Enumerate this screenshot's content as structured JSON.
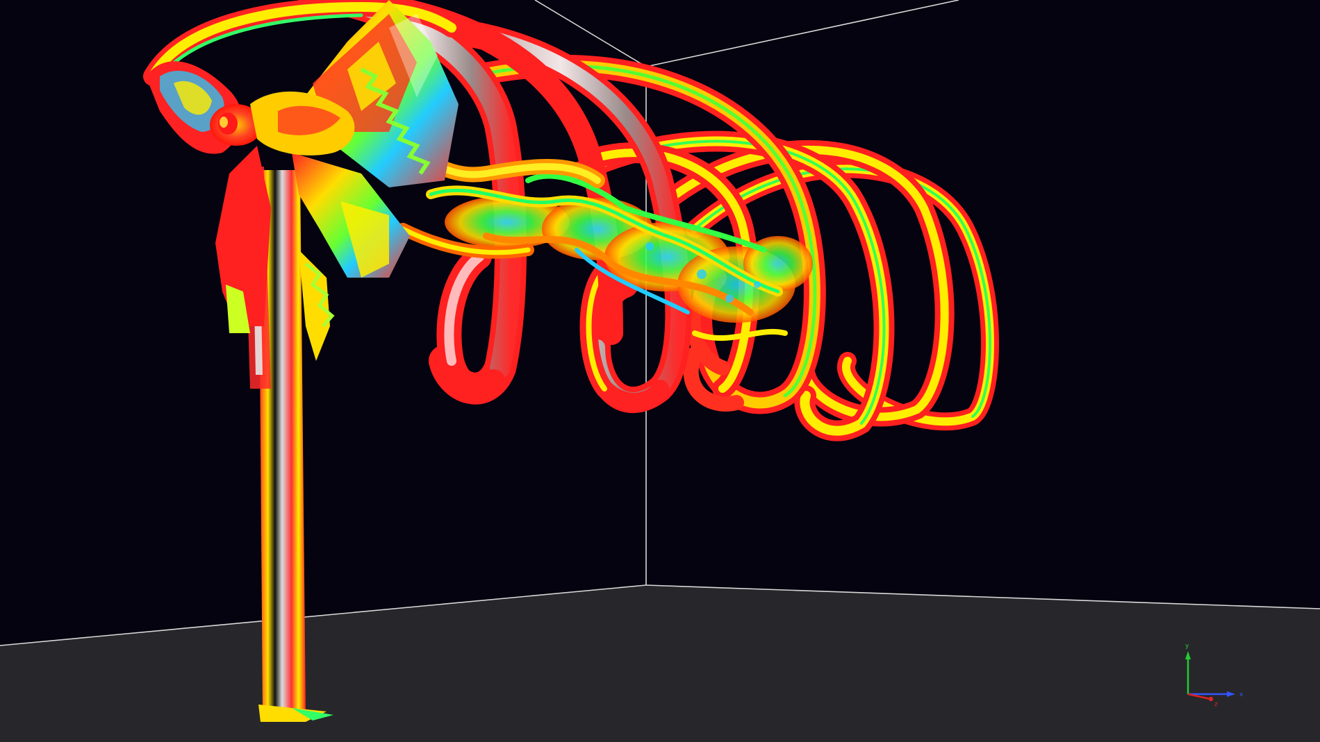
{
  "viewport": {
    "name": "3d-render-viewport",
    "background_color": "#04030f",
    "floor_color": "#27272b",
    "edge_color": "#d9d9d9"
  },
  "scene": {
    "subject": "turbine-wake-vortex-isosurface",
    "colormap": [
      "#00aaff",
      "#22ff66",
      "#ffff00",
      "#ff8800",
      "#ff2020",
      "#b8b8b8"
    ]
  },
  "axis_triad": {
    "labels": {
      "y": "y",
      "x": "x",
      "z": "z"
    },
    "colors": {
      "y": "#22cc33",
      "x": "#3355ff",
      "z": "#dd2222"
    }
  }
}
